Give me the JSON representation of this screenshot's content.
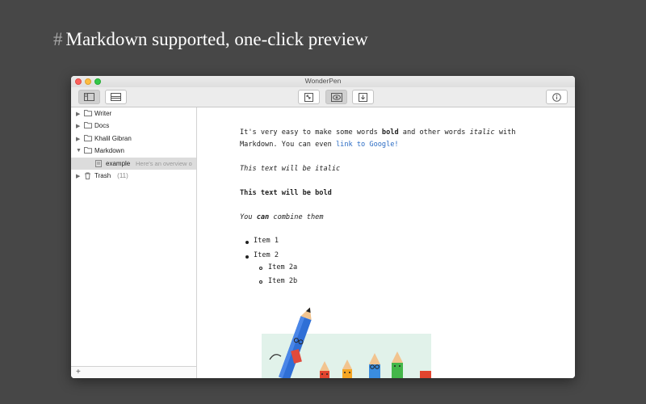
{
  "headline": {
    "hash": "#",
    "text": "Markdown supported, one-click preview"
  },
  "window": {
    "title": "WonderPen"
  },
  "toolbar": {
    "buttons": [
      {
        "name": "toggle-sidebar",
        "icon": "sidebar-icon",
        "active": true
      },
      {
        "name": "toggle-outline",
        "icon": "panel-icon",
        "active": false
      },
      {
        "name": "fullscreen",
        "icon": "expand-icon",
        "active": false
      },
      {
        "name": "preview",
        "icon": "eye-icon",
        "active": true
      },
      {
        "name": "export",
        "icon": "download-icon",
        "active": false
      },
      {
        "name": "info",
        "icon": "info-icon",
        "active": false
      }
    ]
  },
  "sidebar": {
    "items": [
      {
        "label": "Writer",
        "expanded": false
      },
      {
        "label": "Docs",
        "expanded": false
      },
      {
        "label": "Khalil Gibran",
        "expanded": false
      },
      {
        "label": "Markdown",
        "expanded": true
      },
      {
        "label": "example",
        "snippet": "Here's an overview o",
        "selected": true
      },
      {
        "label": "Trash",
        "count": "(11)"
      }
    ],
    "add_label": "+"
  },
  "preview": {
    "para1": {
      "a": "It's very easy to make some words ",
      "bold": "bold",
      "b": " and other words ",
      "italic": "italic",
      "c": " with",
      "line2a": "Markdown. You can even ",
      "link": "link to Google!"
    },
    "italic_line": "This text will be italic",
    "bold_line": "This text will be bold",
    "combine": {
      "a": "You ",
      "b": "can",
      "c": " combine them"
    },
    "list": [
      {
        "text": "Item 1"
      },
      {
        "text": "Item 2",
        "children": [
          "Item 2a",
          "Item 2b"
        ]
      }
    ]
  },
  "colors": {
    "background": "#474747",
    "link": "#2b6cc4",
    "selection": "#dcdcdc"
  }
}
